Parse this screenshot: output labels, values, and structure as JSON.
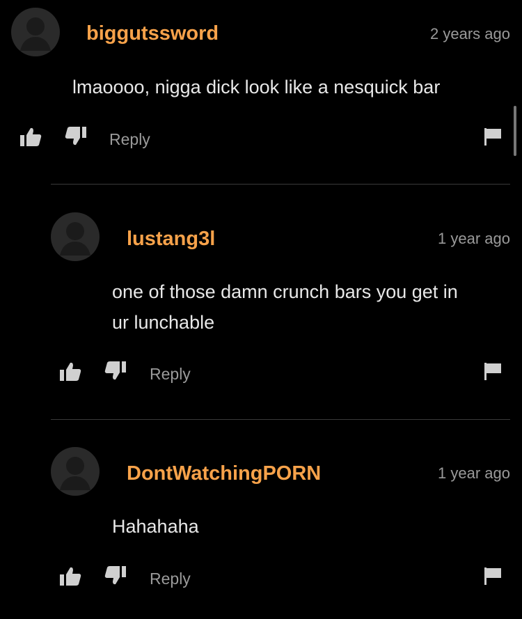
{
  "comments": [
    {
      "username": "biggutssword",
      "timestamp": "2 years ago",
      "text": "lmaoooo, nigga dick look like a nesquick bar",
      "reply_label": "Reply"
    },
    {
      "username": "lustang3l",
      "timestamp": "1 year ago",
      "text": "one of those damn crunch bars you get in\nur lunchable",
      "reply_label": "Reply"
    },
    {
      "username": "DontWatchingPORN",
      "timestamp": "1 year ago",
      "text": "Hahahaha",
      "reply_label": "Reply"
    }
  ],
  "icons": {
    "like": "thumbs-up-icon",
    "dislike": "thumbs-down-icon",
    "flag": "flag-icon"
  },
  "colors": {
    "background": "#000000",
    "username": "#f7a24a",
    "muted": "#9a9a9a",
    "text": "#e8e8e8"
  }
}
